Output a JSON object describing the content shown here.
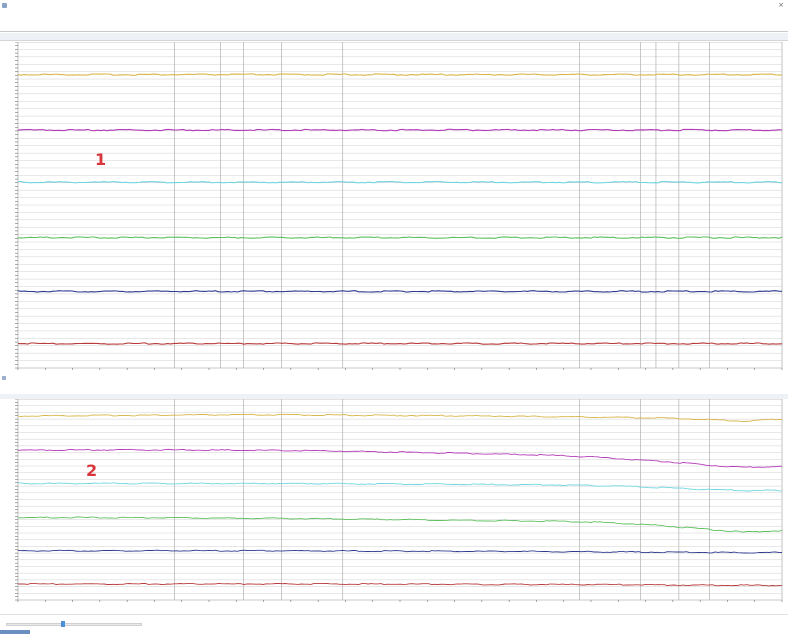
{
  "window1": {
    "title": "",
    "menu_items": [
      "",
      ""
    ],
    "tabs": [
      "",
      "",
      "",
      ""
    ],
    "section_label": ""
  },
  "window2": {
    "title": "",
    "tabs": [
      "",
      "",
      "",
      ""
    ]
  },
  "markers": [
    "1",
    "2"
  ],
  "status": {
    "label": "",
    "slider_value": "",
    "slider_position": 0.42
  },
  "colors": {
    "yellow": "#d9b64a",
    "magenta": "#b43ab8",
    "cyan": "#6fd6e0",
    "green": "#5ec05e",
    "navy": "#2e3a8f",
    "red": "#b83a3a",
    "grid": "#d0d0d0",
    "major_grid": "#b0b0b0",
    "marker_red": "#d9363b"
  },
  "chart_data": [
    {
      "type": "line",
      "title": "",
      "xlabel": "",
      "ylabel": "",
      "x": [
        0,
        0.05,
        0.1,
        0.15,
        0.2,
        0.25,
        0.3,
        0.35,
        0.4,
        0.45,
        0.5,
        0.55,
        0.6,
        0.65,
        0.7,
        0.75,
        0.8,
        0.85,
        0.9,
        0.95,
        1.0
      ],
      "ylim": [
        0,
        1
      ],
      "grid": true,
      "series": [
        {
          "color": "#d9b64a",
          "values": [
            0.9,
            0.9,
            0.9,
            0.9,
            0.9,
            0.9,
            0.9,
            0.9,
            0.9,
            0.9,
            0.9,
            0.9,
            0.9,
            0.9,
            0.9,
            0.9,
            0.9,
            0.9,
            0.9,
            0.9,
            0.9
          ]
        },
        {
          "color": "#b43ab8",
          "values": [
            0.73,
            0.73,
            0.73,
            0.73,
            0.73,
            0.73,
            0.73,
            0.73,
            0.73,
            0.73,
            0.73,
            0.73,
            0.73,
            0.73,
            0.73,
            0.73,
            0.73,
            0.73,
            0.73,
            0.73,
            0.73
          ]
        },
        {
          "color": "#6fd6e0",
          "values": [
            0.57,
            0.57,
            0.57,
            0.57,
            0.57,
            0.57,
            0.57,
            0.57,
            0.57,
            0.57,
            0.57,
            0.57,
            0.57,
            0.57,
            0.57,
            0.57,
            0.57,
            0.57,
            0.57,
            0.57,
            0.57
          ]
        },
        {
          "color": "#5ec05e",
          "values": [
            0.4,
            0.4,
            0.4,
            0.4,
            0.4,
            0.4,
            0.4,
            0.4,
            0.4,
            0.4,
            0.4,
            0.4,
            0.4,
            0.4,
            0.4,
            0.4,
            0.4,
            0.4,
            0.4,
            0.4,
            0.4
          ]
        },
        {
          "color": "#2e3a8f",
          "values": [
            0.235,
            0.235,
            0.235,
            0.235,
            0.235,
            0.235,
            0.235,
            0.235,
            0.235,
            0.235,
            0.235,
            0.235,
            0.235,
            0.235,
            0.235,
            0.235,
            0.235,
            0.235,
            0.235,
            0.235,
            0.235
          ]
        },
        {
          "color": "#b83a3a",
          "values": [
            0.075,
            0.075,
            0.075,
            0.075,
            0.075,
            0.075,
            0.075,
            0.075,
            0.075,
            0.075,
            0.075,
            0.075,
            0.075,
            0.075,
            0.075,
            0.075,
            0.075,
            0.075,
            0.075,
            0.075,
            0.075
          ]
        }
      ]
    },
    {
      "type": "line",
      "title": "",
      "xlabel": "",
      "ylabel": "",
      "x": [
        0,
        0.05,
        0.1,
        0.15,
        0.2,
        0.25,
        0.3,
        0.35,
        0.4,
        0.45,
        0.5,
        0.55,
        0.6,
        0.65,
        0.7,
        0.75,
        0.8,
        0.85,
        0.9,
        0.95,
        1.0
      ],
      "ylim": [
        0,
        1
      ],
      "grid": true,
      "series": [
        {
          "color": "#d9b64a",
          "values": [
            0.915,
            0.917,
            0.918,
            0.919,
            0.92,
            0.921,
            0.921,
            0.921,
            0.92,
            0.919,
            0.918,
            0.917,
            0.916,
            0.914,
            0.912,
            0.91,
            0.908,
            0.905,
            0.898,
            0.89,
            0.9
          ]
        },
        {
          "color": "#b43ab8",
          "values": [
            0.745,
            0.746,
            0.747,
            0.747,
            0.747,
            0.746,
            0.745,
            0.744,
            0.742,
            0.739,
            0.736,
            0.732,
            0.728,
            0.724,
            0.72,
            0.712,
            0.7,
            0.688,
            0.672,
            0.66,
            0.665
          ]
        },
        {
          "color": "#6fd6e0",
          "values": [
            0.58,
            0.58,
            0.58,
            0.58,
            0.58,
            0.58,
            0.58,
            0.58,
            0.579,
            0.578,
            0.577,
            0.576,
            0.575,
            0.574,
            0.573,
            0.57,
            0.565,
            0.558,
            0.55,
            0.545,
            0.545
          ]
        },
        {
          "color": "#5ec05e",
          "values": [
            0.41,
            0.41,
            0.41,
            0.409,
            0.409,
            0.408,
            0.407,
            0.406,
            0.404,
            0.402,
            0.4,
            0.398,
            0.396,
            0.394,
            0.392,
            0.388,
            0.38,
            0.368,
            0.352,
            0.338,
            0.345
          ]
        },
        {
          "color": "#2e3a8f",
          "values": [
            0.245,
            0.245,
            0.245,
            0.245,
            0.245,
            0.245,
            0.245,
            0.245,
            0.244,
            0.244,
            0.243,
            0.243,
            0.242,
            0.242,
            0.241,
            0.24,
            0.239,
            0.238,
            0.237,
            0.236,
            0.236
          ]
        },
        {
          "color": "#b83a3a",
          "values": [
            0.08,
            0.08,
            0.08,
            0.08,
            0.08,
            0.08,
            0.08,
            0.08,
            0.08,
            0.079,
            0.079,
            0.079,
            0.078,
            0.078,
            0.077,
            0.077,
            0.076,
            0.075,
            0.074,
            0.073,
            0.073
          ]
        }
      ]
    }
  ]
}
